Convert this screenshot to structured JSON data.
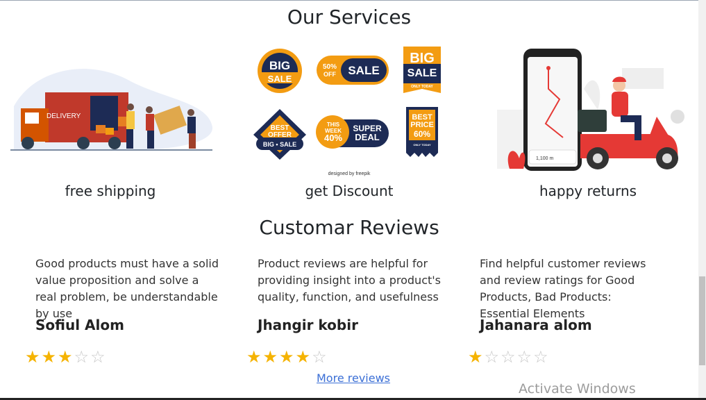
{
  "services": {
    "title": "Our Services",
    "items": [
      {
        "label": "free shipping",
        "image_text": "DELIVERY"
      },
      {
        "label": "get Discount",
        "credit": "designed by freepik"
      },
      {
        "label": "happy returns",
        "map_text": "1,100 m"
      }
    ],
    "badges": {
      "big_sale_1": [
        "BIG",
        "SALE"
      ],
      "sale_50": [
        "50%",
        "OFF",
        "SALE"
      ],
      "big_sale_2": [
        "BIG",
        "SALE",
        "ONLY TODAY"
      ],
      "best_offer": [
        "BEST",
        "OFFER",
        "BIG • SALE"
      ],
      "super_deal": [
        "THIS",
        "WEEK",
        "40%",
        "SUPER",
        "DEAL"
      ],
      "best_price": [
        "BEST",
        "PRICE",
        "60%",
        "ONLY TODAY"
      ]
    }
  },
  "reviews": {
    "title": "Customar Reviews",
    "items": [
      {
        "text": "Good products must have a solid value proposition and solve a real problem, be understandable by use",
        "name": "Sofiul Alom",
        "stars": "★★★☆☆"
      },
      {
        "text": "Product reviews are helpful for providing insight into a product's quality, function, and usefulness",
        "name": "Jhangir kobir",
        "stars": "★★★★☆"
      },
      {
        "text": "Find helpful customer reviews and review ratings for Good Products, Bad Products: Essential Elements",
        "name": "Jahanara alom",
        "stars": "★☆☆☆☆"
      }
    ],
    "rating_values": [
      3,
      4,
      1
    ],
    "more_link": "More reviews"
  },
  "system": {
    "watermark": "Activate Windows"
  },
  "colors": {
    "star": "#f5b301",
    "truck": "#c0392b",
    "orange": "#f39c12",
    "navy": "#1d2b55",
    "scooter": "#e53935"
  }
}
